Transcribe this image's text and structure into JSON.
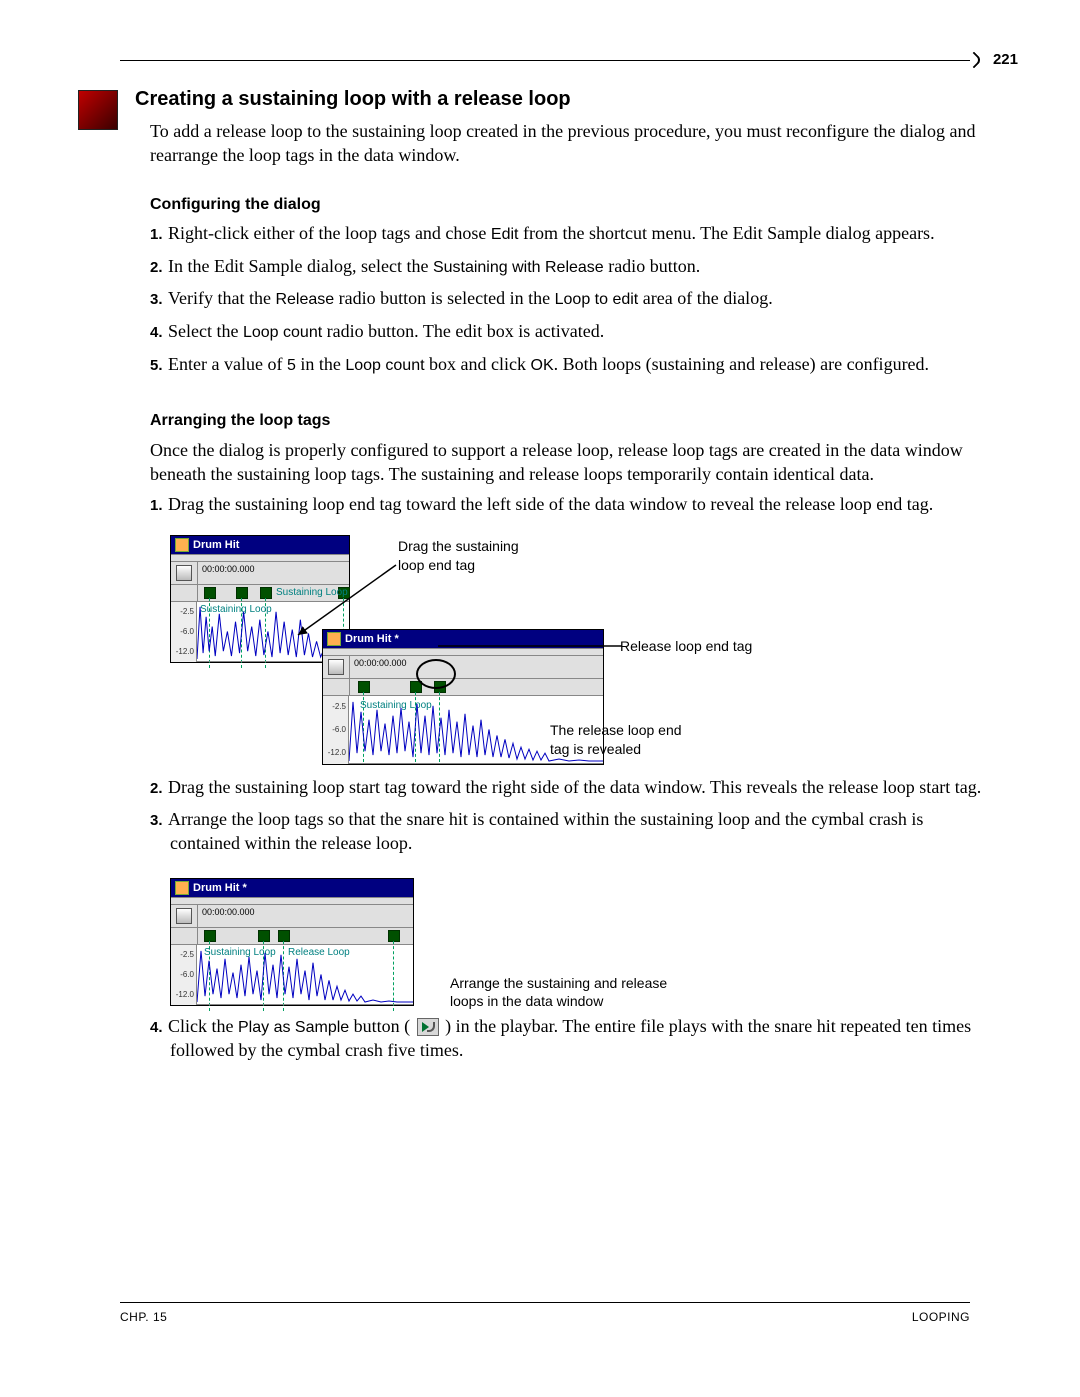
{
  "page_number": "221",
  "section_title": "Creating a sustaining loop with a release loop",
  "intro": "To add a release loop to the sustaining loop created in the previous procedure, you must reconfigure the dialog and rearrange the loop tags in the data window.",
  "sub1": "Configuring the dialog",
  "steps1": {
    "s1a": "Right-click either of the loop tags and chose ",
    "s1b": "Edit",
    "s1c": " from the shortcut menu. The Edit Sample dialog appears.",
    "s2a": "In the Edit Sample dialog, select the ",
    "s2b": "Sustaining with Release",
    "s2c": " radio button.",
    "s3a": "Verify that the ",
    "s3b": "Release",
    "s3c": " radio button is selected in the ",
    "s3d": "Loop to edit",
    "s3e": " area of the dialog.",
    "s4a": "Select the ",
    "s4b": "Loop count",
    "s4c": " radio button. The edit box is activated.",
    "s5a": "Enter a value of ",
    "s5b": "5",
    "s5c": " in the ",
    "s5d": "Loop count",
    "s5e": " box and click ",
    "s5f": "OK",
    "s5g": ". Both loops (sustaining and release) are configured."
  },
  "sub2": "Arranging the loop tags",
  "intro2": "Once the dialog is properly configured to support a release loop, release loop tags are created in the data window beneath the sustaining loop tags. The sustaining and release loops temporarily contain identical data.",
  "steps2": {
    "s1": "Drag the sustaining loop end tag toward the left side of the data window to reveal the release loop end tag.",
    "s2": "Drag the sustaining loop start tag toward the right side of the data window. This reveals the release loop start tag.",
    "s3": "Arrange the loop tags so that the snare hit is contained within the sustaining loop and the cymbal crash is contained within the release loop.",
    "s4a": "Click the ",
    "s4b": "Play as Sample",
    "s4c": " button ( ",
    "s4d": " ) in the playbar. The entire file plays with the snare hit repeated ten times followed by the cymbal crash five times."
  },
  "fig1": {
    "titleA": "Drum Hit",
    "titleB": "Drum Hit *",
    "time": "00:00:00.000",
    "sustaining": "Sustaining Loop",
    "axis": {
      "a": "-2.5",
      "b": "-6.0",
      "c": "-12.0"
    },
    "anno1a": "Drag the sustaining",
    "anno1b": "loop end tag",
    "anno2": "Release loop end tag",
    "anno3a": "The release loop end",
    "anno3b": "tag is revealed"
  },
  "fig2": {
    "title": "Drum Hit *",
    "time": "00:00:00.000",
    "sustaining": "Sustaining Loop",
    "release": "Release Loop",
    "axis": {
      "a": "-2.5",
      "b": "-6.0",
      "c": "-12.0"
    },
    "anno1a": "Arrange the sustaining and release",
    "anno1b": "loops in the data window"
  },
  "footer_left": "CHP. 15",
  "footer_right": "LOOPING"
}
